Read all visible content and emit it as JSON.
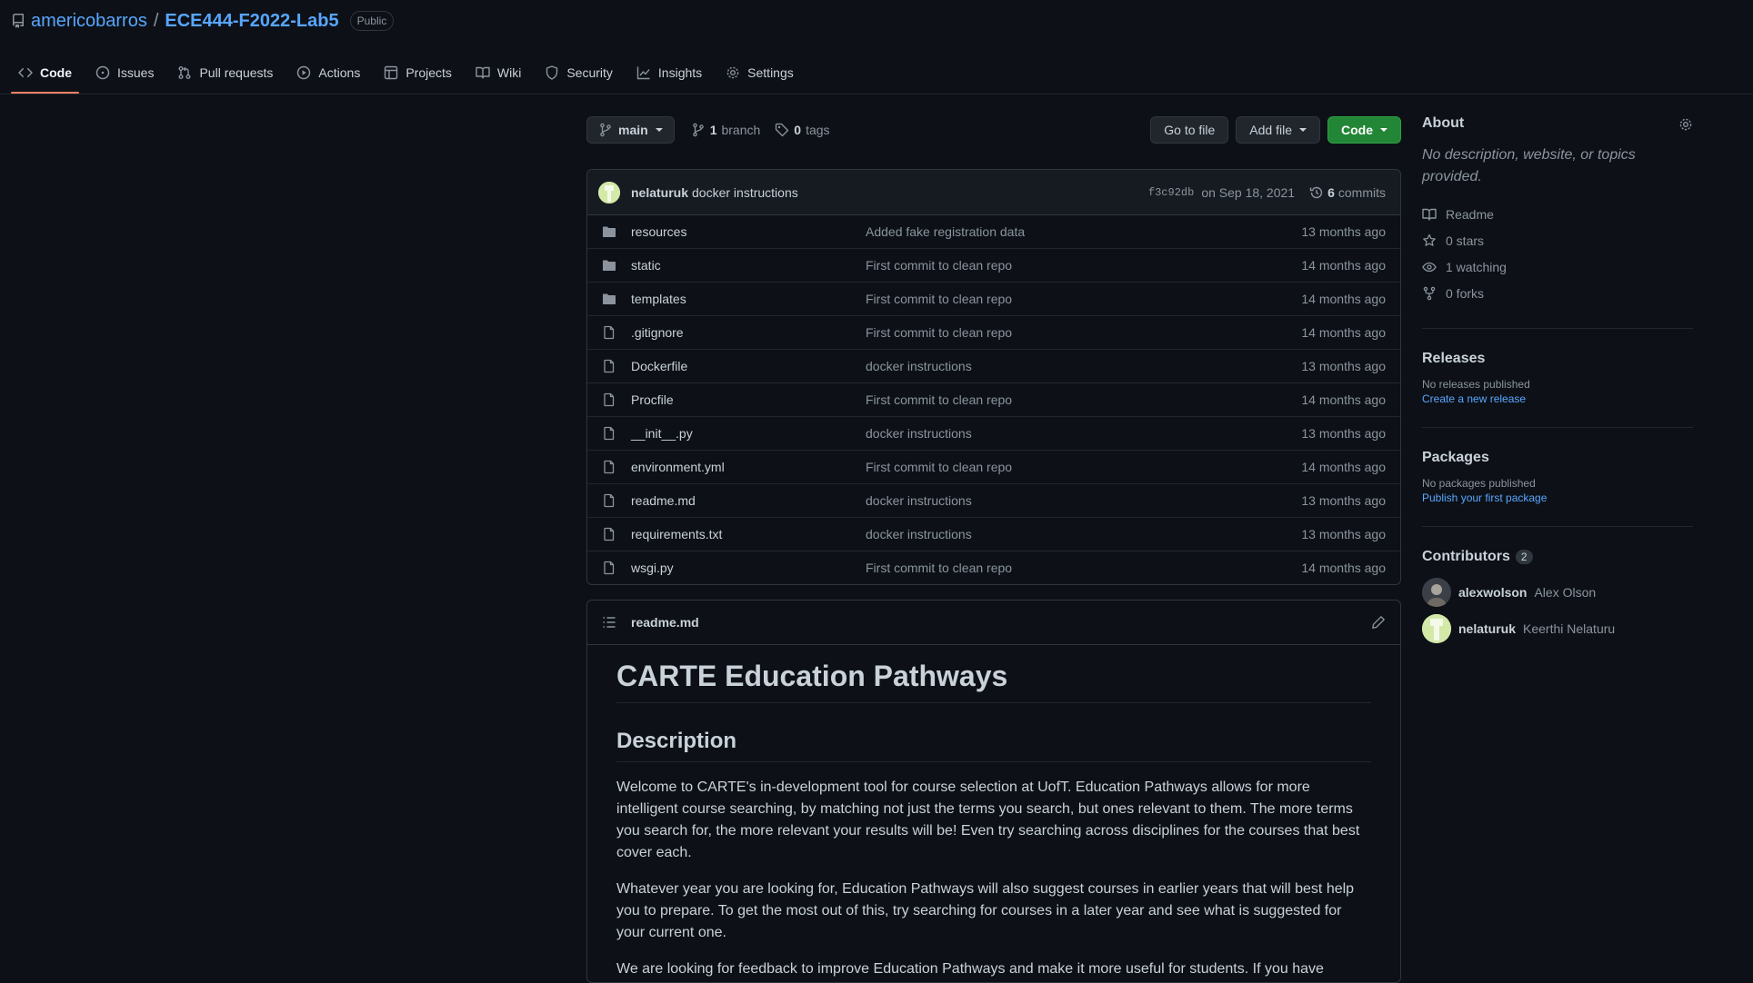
{
  "repo": {
    "owner": "americobarros",
    "separator": "/",
    "name": "ECE444-F2022-Lab5",
    "visibility": "Public"
  },
  "tabs": [
    {
      "label": "Code",
      "icon": "code-icon",
      "active": true
    },
    {
      "label": "Issues",
      "icon": "issue-icon"
    },
    {
      "label": "Pull requests",
      "icon": "pull-request-icon"
    },
    {
      "label": "Actions",
      "icon": "play-icon"
    },
    {
      "label": "Projects",
      "icon": "table-icon"
    },
    {
      "label": "Wiki",
      "icon": "book-icon"
    },
    {
      "label": "Security",
      "icon": "shield-icon"
    },
    {
      "label": "Insights",
      "icon": "graph-icon"
    },
    {
      "label": "Settings",
      "icon": "gear-icon"
    }
  ],
  "toolbar": {
    "branch": "main",
    "branch_count": "1",
    "branch_label": "branch",
    "tag_count": "0",
    "tag_label": "tags",
    "go_to_file": "Go to file",
    "add_file": "Add file",
    "code": "Code"
  },
  "commit": {
    "author": "nelaturuk",
    "message": "docker instructions",
    "sha": "f3c92db",
    "date": "on Sep 18, 2021",
    "count": "6",
    "count_label": "commits"
  },
  "files": [
    {
      "name": "resources",
      "type": "dir",
      "message": "Added fake registration data",
      "age": "13 months ago"
    },
    {
      "name": "static",
      "type": "dir",
      "message": "First commit to clean repo",
      "age": "14 months ago"
    },
    {
      "name": "templates",
      "type": "dir",
      "message": "First commit to clean repo",
      "age": "14 months ago"
    },
    {
      "name": ".gitignore",
      "type": "file",
      "message": "First commit to clean repo",
      "age": "14 months ago"
    },
    {
      "name": "Dockerfile",
      "type": "file",
      "message": "docker instructions",
      "age": "13 months ago"
    },
    {
      "name": "Procfile",
      "type": "file",
      "message": "First commit to clean repo",
      "age": "14 months ago"
    },
    {
      "name": "__init__.py",
      "type": "file",
      "message": "docker instructions",
      "age": "13 months ago"
    },
    {
      "name": "environment.yml",
      "type": "file",
      "message": "First commit to clean repo",
      "age": "14 months ago"
    },
    {
      "name": "readme.md",
      "type": "file",
      "message": "docker instructions",
      "age": "13 months ago"
    },
    {
      "name": "requirements.txt",
      "type": "file",
      "message": "docker instructions",
      "age": "13 months ago"
    },
    {
      "name": "wsgi.py",
      "type": "file",
      "message": "First commit to clean repo",
      "age": "14 months ago"
    }
  ],
  "readme": {
    "filename": "readme.md",
    "h1": "CARTE Education Pathways",
    "h2": "Description",
    "paragraphs": [
      "Welcome to CARTE's in-development tool for course selection at UofT. Education Pathways allows for more intelligent course searching, by matching not just the terms you search, but ones relevant to them. The more terms you search for, the more relevant your results will be! Even try searching across disciplines for the courses that best cover each.",
      "Whatever year you are looking for, Education Pathways will also suggest courses in earlier years that will best help you to prepare. To get the most out of this, try searching for courses in a later year and see what is suggested for your current one.",
      "We are looking for feedback to improve Education Pathways and make it more useful for students. If you have"
    ]
  },
  "sidebar": {
    "about_title": "About",
    "about_desc": "No description, website, or topics provided.",
    "stats": [
      {
        "icon": "book-icon",
        "label": "Readme"
      },
      {
        "icon": "star-icon",
        "label": "0 stars"
      },
      {
        "icon": "eye-icon",
        "label": "1 watching"
      },
      {
        "icon": "fork-icon",
        "label": "0 forks"
      }
    ],
    "releases_title": "Releases",
    "releases_none": "No releases published",
    "releases_link": "Create a new release",
    "packages_title": "Packages",
    "packages_none": "No packages published",
    "packages_link": "Publish your first package",
    "contributors_title": "Contributors",
    "contributors_count": "2",
    "contributors": [
      {
        "login": "alexwolson",
        "name": "Alex Olson"
      },
      {
        "login": "nelaturuk",
        "name": "Keerthi Nelaturu"
      }
    ]
  },
  "colors": {
    "background": "#0d1117",
    "link": "#58a6ff",
    "primary_button": "#238636",
    "active_tab_underline": "#f78166"
  }
}
